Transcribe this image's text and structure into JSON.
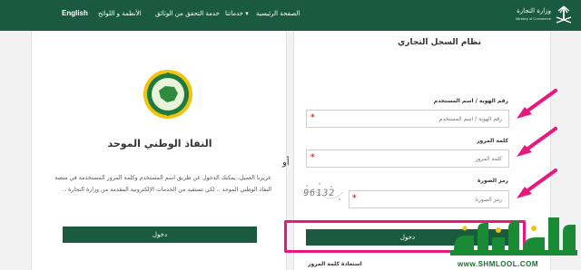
{
  "header": {
    "brand_name": "وزارة التجارة",
    "brand_sub": "Ministry of Commerce",
    "nav": [
      "الصفحة الرئيسية",
      "خدماتنا ▾",
      "خدمة التحقق من الوثائق",
      "الأنظمة و اللوائح",
      "English"
    ]
  },
  "nafath": {
    "title": "النفاذ الوطني الموحد",
    "description": "عزيزنا العميل، يمكنك الدخول عن طريق اسم المستخدم وكلمة المرور المستخدمة في منصة النفاذ الوطني الموحد .. لكي تستفيد من الخدمات الإلكترونية المقدمة من وزارة التجارة ..",
    "login_label": "دخول"
  },
  "separator": {
    "or_label": "أو"
  },
  "cr_login": {
    "title": "نظام السجل التجاري",
    "id_label": "رقم الهوية / اسم المستخدم",
    "id_placeholder": "رقم الهوية / اسم المستخدم",
    "password_label": "كلمة المرور",
    "password_placeholder": "كلمة المرور",
    "captcha_label": "رمز الصورة",
    "captcha_placeholder": "رمز الصورة",
    "captcha_text": "96132",
    "required_mark": "*",
    "login_label": "دخول",
    "recover_label": "استعادة كلمة المرور"
  },
  "watermark": {
    "site": "www.SHMLOOL.COM"
  },
  "colors": {
    "primary": "#1a5a3e",
    "highlight": "#e8197e",
    "required": "#c0392b"
  }
}
